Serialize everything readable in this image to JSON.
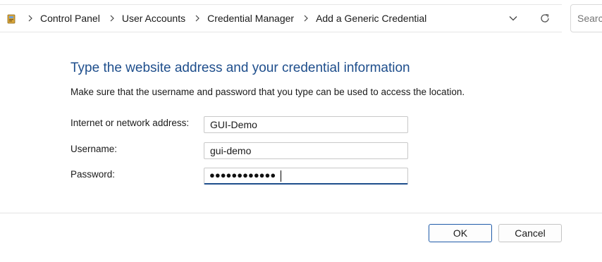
{
  "address_bar": {
    "location_icon": "control-panel-icon",
    "breadcrumbs": [
      "Control Panel",
      "User Accounts",
      "Credential Manager",
      "Add a Generic Credential"
    ],
    "dropdown_icon": "chevron-down-icon",
    "refresh_icon": "refresh-icon",
    "search_placeholder": "Search"
  },
  "form": {
    "heading": "Type the website address and your credential information",
    "instruction": "Make sure that the username and password that you type can be used to access the location.",
    "address_label": "Internet or network address:",
    "address_value": "GUI-Demo",
    "username_label": "Username:",
    "username_value": "gui-demo",
    "password_label": "Password:",
    "password_masked": "●●●●●●●●●●●●"
  },
  "buttons": {
    "ok": "OK",
    "cancel": "Cancel"
  },
  "colors": {
    "heading": "#1e4e8c",
    "focus_accent": "#1e4e8c",
    "primary_border": "#1e5aa8"
  }
}
